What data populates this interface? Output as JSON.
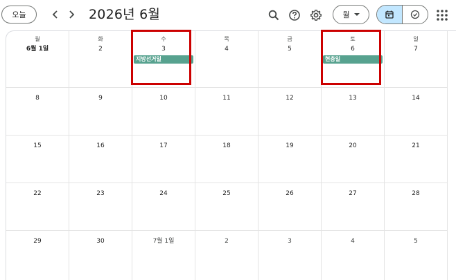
{
  "toolbar": {
    "today_label": "오늘",
    "title": "2026년 6월",
    "view_label": "월"
  },
  "weekdays": [
    "월",
    "화",
    "수",
    "목",
    "금",
    "토",
    "일"
  ],
  "weeks": [
    [
      "6월 1일",
      "2",
      "3",
      "4",
      "5",
      "6",
      "7"
    ],
    [
      "8",
      "9",
      "10",
      "11",
      "12",
      "13",
      "14"
    ],
    [
      "15",
      "16",
      "17",
      "18",
      "19",
      "20",
      "21"
    ],
    [
      "22",
      "23",
      "24",
      "25",
      "26",
      "27",
      "28"
    ],
    [
      "29",
      "30",
      "7월 1일",
      "2",
      "3",
      "4",
      "5"
    ]
  ],
  "events": {
    "wed_jun3": "지방선거일",
    "sat_jun6": "현충일"
  },
  "colors": {
    "event": "#57a28f",
    "highlight": "#cc0000",
    "active_toggle": "#c2e7ff"
  }
}
